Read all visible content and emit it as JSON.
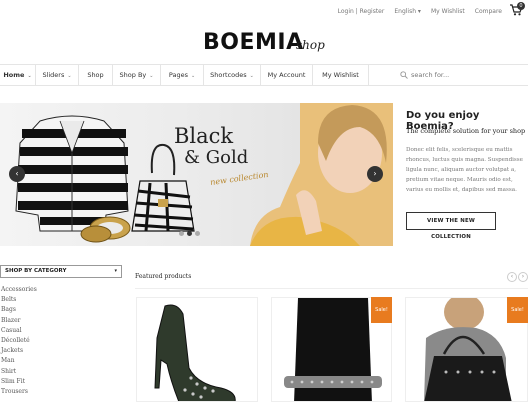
{
  "toplinks": [
    "Login | Register",
    "English ▾",
    "My Wishlist",
    "Compare"
  ],
  "cart": {
    "count": "0"
  },
  "logo": {
    "main": "BOEMIA",
    "script": "shop"
  },
  "nav": {
    "items": [
      {
        "label": "Home",
        "chevron": true
      },
      {
        "label": "Sliders",
        "chevron": true
      },
      {
        "label": "Shop",
        "chevron": false
      },
      {
        "label": "Shop By",
        "chevron": true
      },
      {
        "label": "Pages",
        "chevron": true
      },
      {
        "label": "Shortcodes",
        "chevron": true
      },
      {
        "label": "My Account",
        "chevron": false
      },
      {
        "label": "My Wishlist",
        "chevron": false
      }
    ],
    "search_placeholder": "search for..."
  },
  "slider": {
    "title_line1": "Black",
    "title_line2": "& Gold",
    "subtitle": "new collection"
  },
  "promo": {
    "heading": "Do you enjoy Boemia?",
    "subheading": "The complete solution for your shop",
    "body": "Donec elit felis, scelerisque eu mattis rhoncus, luctus quis magna. Suspendisse ligula nunc, aliquam auctor volutpat a, pretium vitae neque. Mauris odio est, varius eu mollis et, dapibus sed massa.",
    "button": "VIEW THE NEW COLLECTION"
  },
  "categories": {
    "select_label": "SHOP BY CATEGORY",
    "items": [
      "Accessories",
      "Belts",
      "Bags",
      "Blazer",
      "Casual",
      "Décolleté",
      "Jackets",
      "Man",
      "Shirt",
      "Slim Fit",
      "Trousers"
    ]
  },
  "featured": {
    "title": "Featured products",
    "sale_label": "Sale!"
  },
  "colors": {
    "sale": "#e87b1f",
    "text": "#333333"
  }
}
